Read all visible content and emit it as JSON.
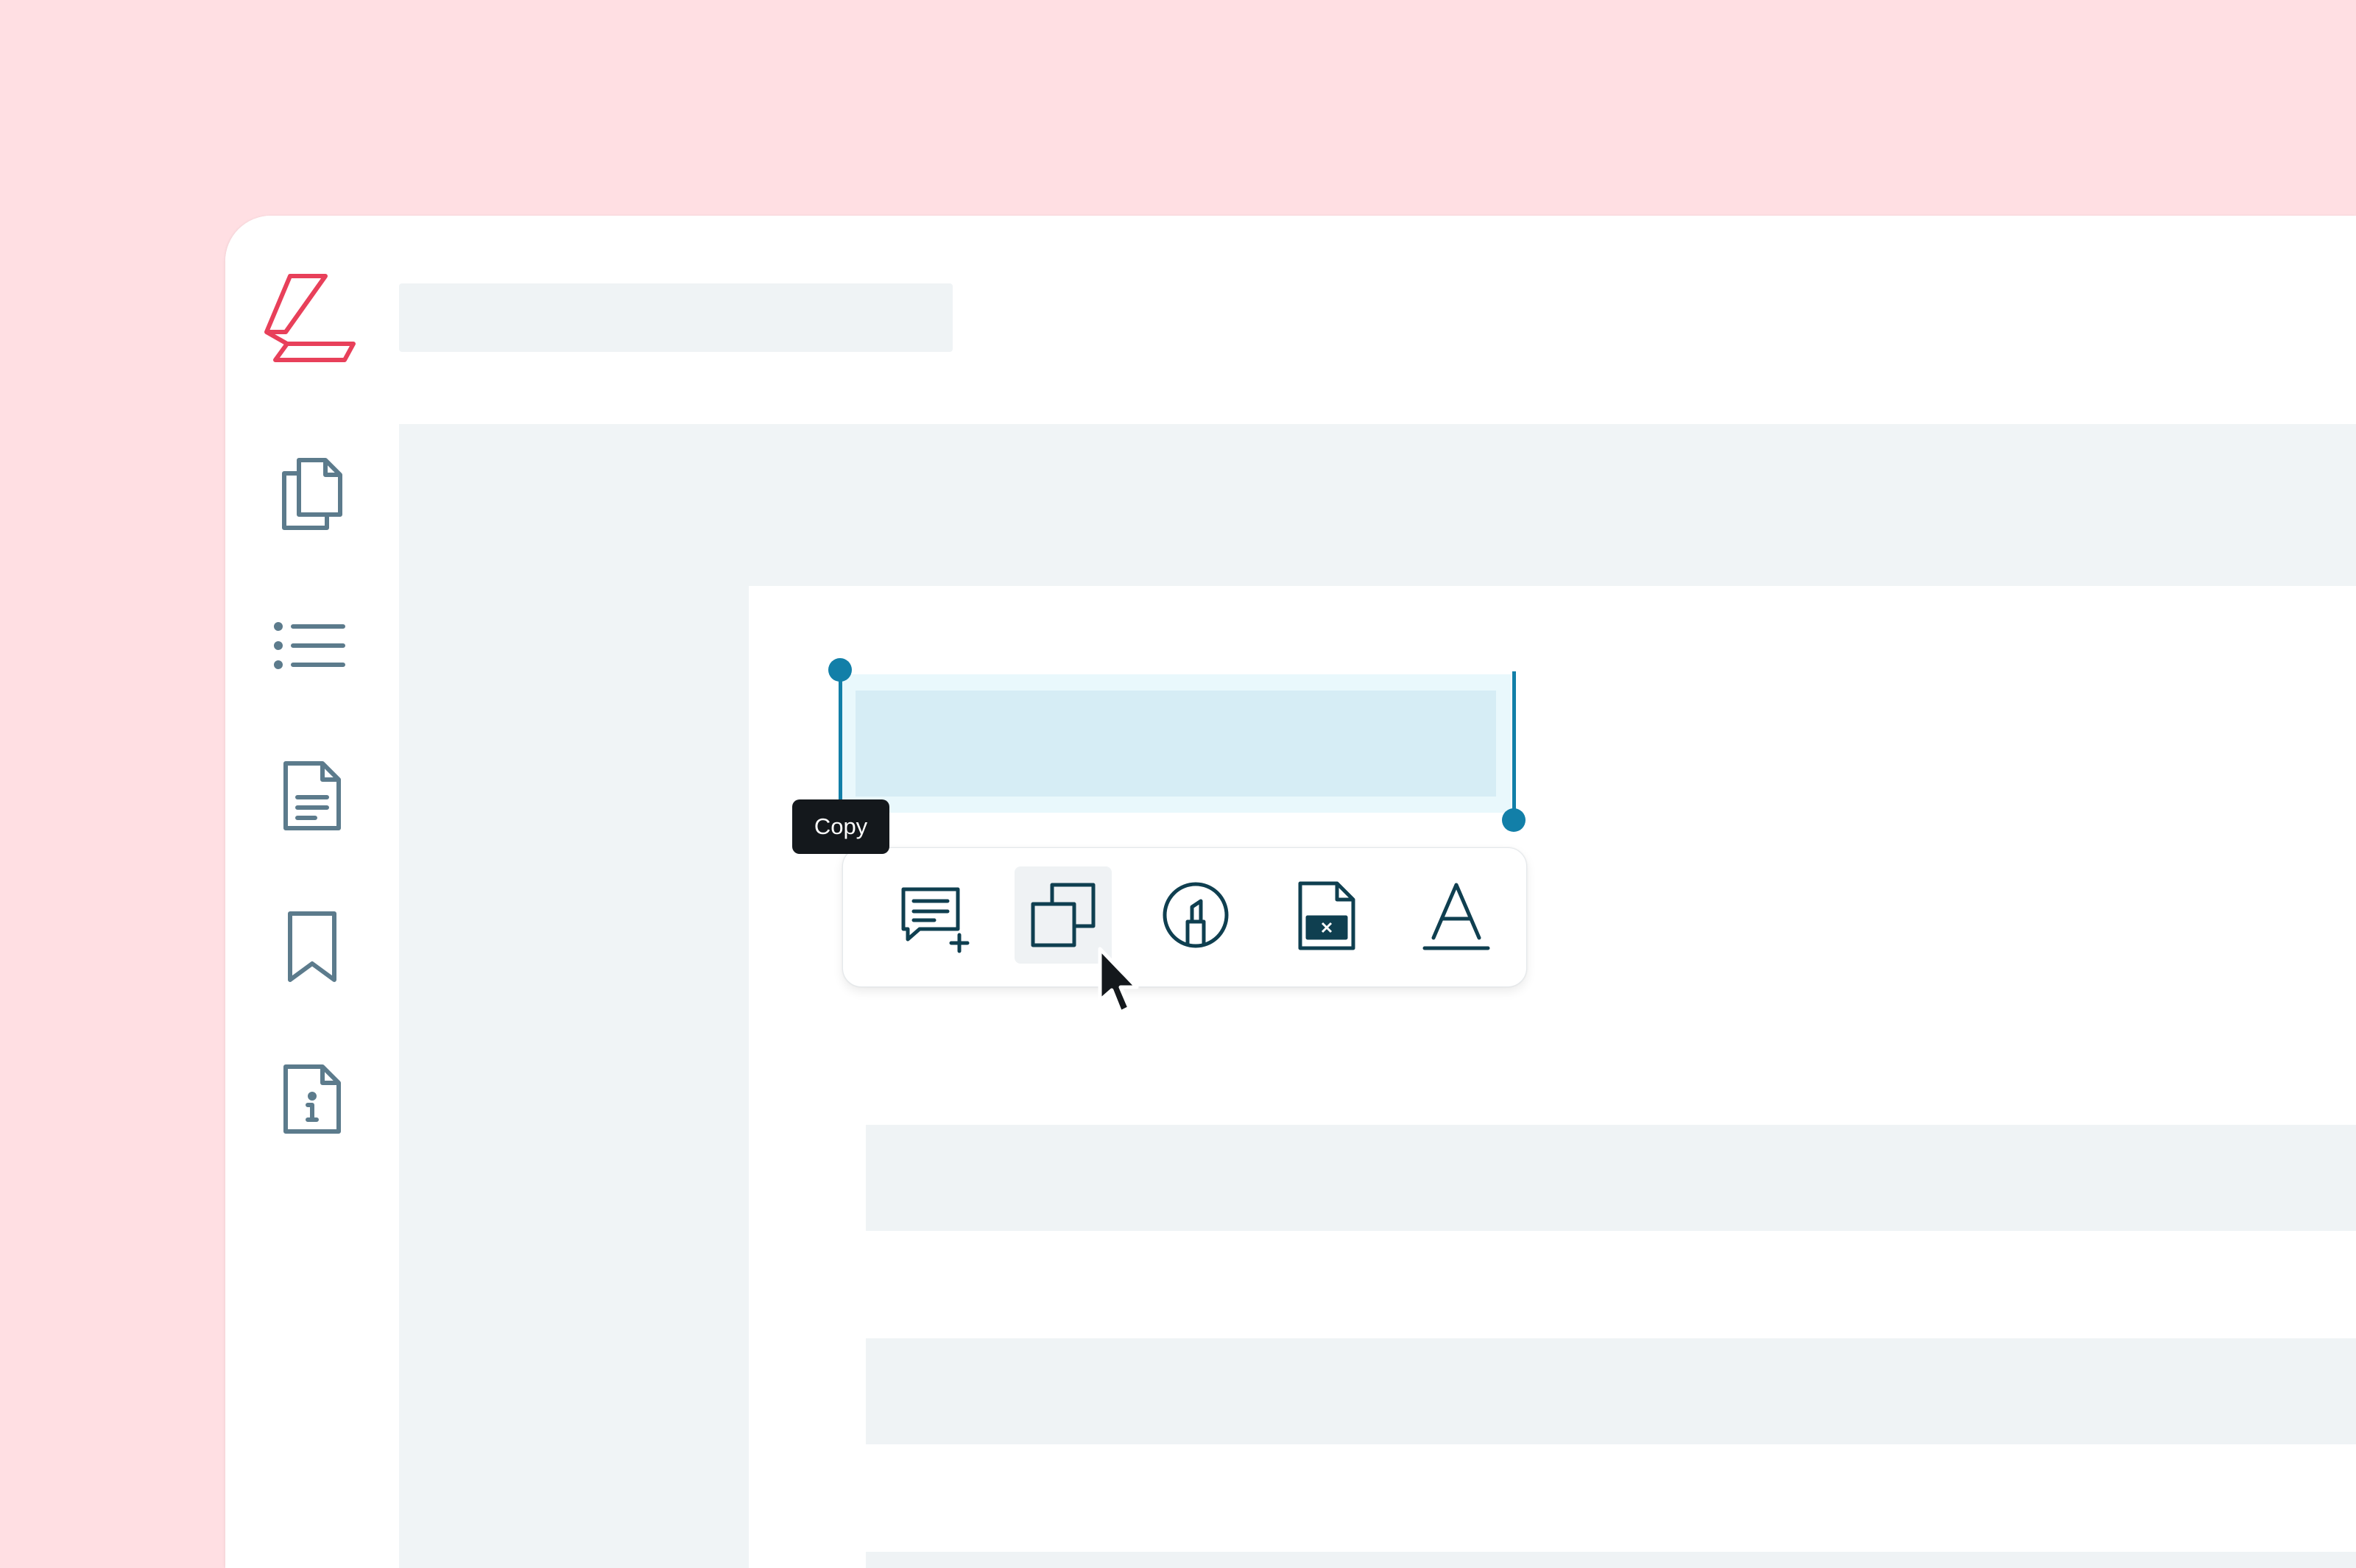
{
  "app": {
    "brand_color": "#E8405A",
    "logo_icon": "stacked-l-logo-icon"
  },
  "header": {
    "title": ""
  },
  "sidebar": {
    "items": [
      {
        "id": "pages",
        "icon": "pages-icon"
      },
      {
        "id": "outline",
        "icon": "list-icon"
      },
      {
        "id": "document",
        "icon": "document-icon"
      },
      {
        "id": "bookmarks",
        "icon": "bookmark-icon"
      },
      {
        "id": "info",
        "icon": "document-info-icon"
      }
    ],
    "icon_color": "#5C7B8C"
  },
  "selection": {
    "highlight_color": "#D6EDF5",
    "handle_color": "#127FA8"
  },
  "toolbar": {
    "items": [
      {
        "id": "add-comment",
        "icon": "add-comment-icon"
      },
      {
        "id": "copy",
        "icon": "copy-icon",
        "hovered": true
      },
      {
        "id": "highlight",
        "icon": "highlighter-icon"
      },
      {
        "id": "redact",
        "icon": "redact-file-icon"
      },
      {
        "id": "underline",
        "icon": "text-underline-icon"
      }
    ],
    "icon_color": "#0F3F50",
    "tooltip": "Copy"
  }
}
